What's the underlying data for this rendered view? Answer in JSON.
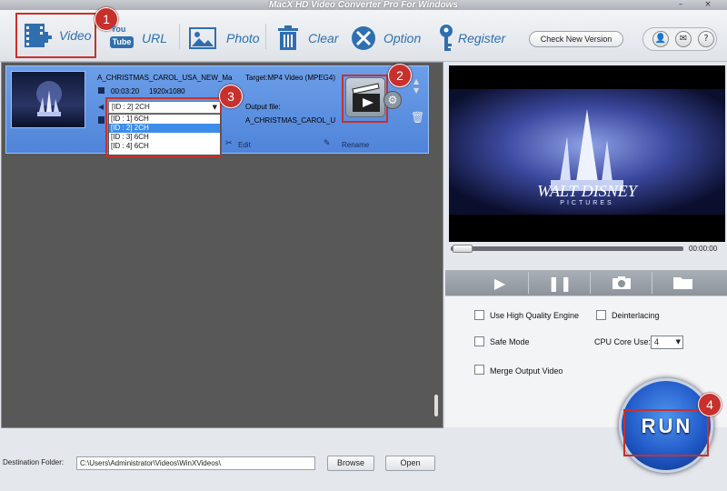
{
  "window": {
    "title": "MacX HD Video Converter Pro For Windows",
    "minimize": "–",
    "close": "×"
  },
  "toolbar": {
    "video": "Video",
    "url": "URL",
    "url_icon_top": "You",
    "url_icon_bottom": "Tube",
    "photo": "Photo",
    "clear": "Clear",
    "option": "Option",
    "register": "Register",
    "check_version": "Check New Version",
    "user_icon": "👤",
    "mail_icon": "✉",
    "help_icon": "?"
  },
  "badges": [
    "1",
    "2",
    "3",
    "4"
  ],
  "file": {
    "name": "A_CHRISTMAS_CAROL_USA_NEW_Ma",
    "duration": "00:03:20",
    "resolution": "1920x1080",
    "target": "Target:MP4 Video (MPEG4)",
    "output_label": "Output file:",
    "output_name": "A_CHRISTMAS_CAROL_U",
    "edit": "Edit",
    "rename": "Rename",
    "audio_selected": "[ID : 2] 2CH",
    "audio_options": [
      "[ID : 1] 6CH",
      "[ID : 2] 2CH",
      "[ID : 3] 6CH",
      "[ID : 4] 6CH"
    ],
    "selected_index": 1
  },
  "preview": {
    "time": "00:00:00",
    "logo_main": "WALT DISNEY",
    "logo_sub": "PICTURES"
  },
  "options": {
    "high_quality": "Use High Quality Engine",
    "deinterlacing": "Deinterlacing",
    "safe_mode": "Safe Mode",
    "cpu_core_label": "CPU Core Use:",
    "cpu_core_value": "4",
    "merge": "Merge Output Video"
  },
  "run_label": "RUN",
  "destination": {
    "label": "Destination Folder:",
    "path": "C:\\Users\\Administrator\\Videos\\WinXVideos\\",
    "browse": "Browse",
    "open": "Open"
  },
  "colors": {
    "accent": "#2f6fb0",
    "highlight": "#c8302c",
    "selection": "#4f84d9"
  }
}
